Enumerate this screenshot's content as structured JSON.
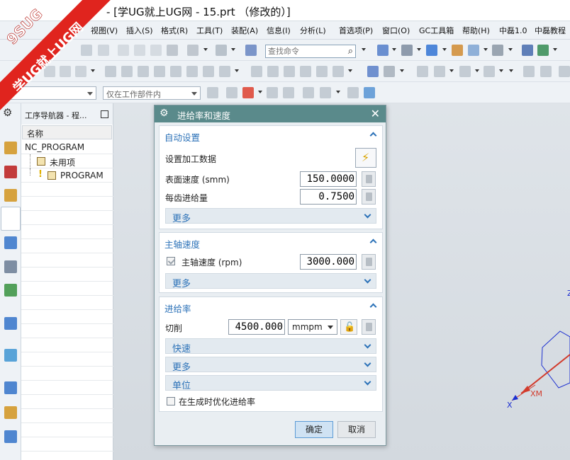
{
  "window": {
    "title": "- [学UG就上UG网 - 15.prt （修改的）]"
  },
  "watermark": {
    "brand": "9SUG",
    "slogan": "学UG就上UG网"
  },
  "menu": [
    "视图(V)",
    "插入(S)",
    "格式(R)",
    "工具(T)",
    "装配(A)",
    "信息(I)",
    "分析(L)",
    "首选项(P)",
    "窗口(O)",
    "GC工具箱",
    "帮助(H)",
    "中磊1.0",
    "中磊教程"
  ],
  "search": {
    "placeholder": "查找命令"
  },
  "filter": {
    "scope": "仅在工作部件内"
  },
  "navigator": {
    "title": "工序导航器 - 程...",
    "column_header": "名称",
    "rows": [
      {
        "label": "NC_PROGRAM"
      },
      {
        "label": "未用项"
      },
      {
        "label": "PROGRAM"
      }
    ]
  },
  "axes": {
    "xm_label": "XM",
    "x_label": "X",
    "z_label": "Z"
  },
  "dialog": {
    "title": "进给率和速度",
    "auto_settings": {
      "header": "自动设置",
      "set_machining_data": "设置加工数据",
      "surface_speed_label": "表面速度 (smm)",
      "surface_speed_value": "150.0000",
      "feed_per_tooth_label": "每齿进给量",
      "feed_per_tooth_value": "0.7500",
      "more_label": "更多"
    },
    "spindle": {
      "header": "主轴速度",
      "spindle_speed_label": "主轴速度 (rpm)",
      "spindle_speed_checked": true,
      "spindle_speed_value": "3000.000",
      "more_label": "更多"
    },
    "feed": {
      "header": "进给率",
      "cut_label": "切削",
      "cut_value": "4500.000",
      "cut_unit": "mmpm",
      "rapid_label": "快速",
      "more_label": "更多",
      "units_label": "单位",
      "optimize_label": "在生成时优化进给率",
      "optimize_checked": false
    },
    "ok_label": "确定",
    "cancel_label": "取消"
  },
  "colors": {
    "dialog_title_bg": "#5a8a8b",
    "section_header_text": "#2c72b8",
    "watermark_red": "#e0241e",
    "ok_button_bg": "#cfe2f3"
  }
}
